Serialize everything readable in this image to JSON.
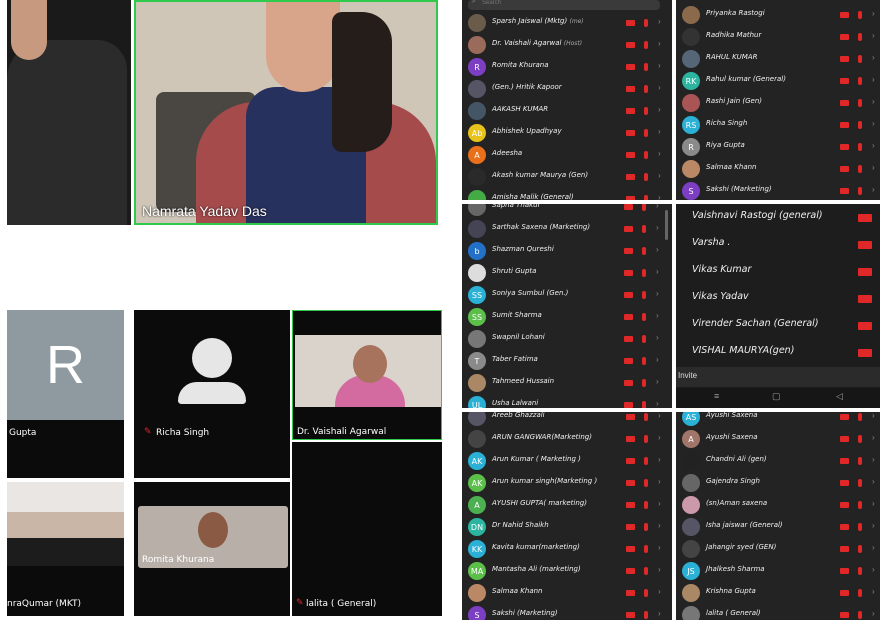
{
  "video": {
    "namrata_label": "Namrata Yadav Das",
    "gupta_label": "Gupta",
    "r_letter": "R",
    "richa_label": "Richa Singh",
    "vaishali_label": "Dr. Vaishali Agarwal",
    "romita_label": "Romita Khurana",
    "qumar_label": "nraQumar (MKT)",
    "lalita_label": "lalita ( General)"
  },
  "panel_a": {
    "search_placeholder": "Search",
    "rows": [
      {
        "name": "Sparsh Jaiswal (Mktg)",
        "note": "(me)",
        "initial": "",
        "color": "#6b5b4b"
      },
      {
        "name": "Dr. Vaishali Agarwal",
        "note": "(Host)",
        "initial": "",
        "color": "#9a6b5a"
      },
      {
        "name": "Romita Khurana",
        "note": "",
        "initial": "R",
        "color": "#7c3fc4"
      },
      {
        "name": "(Gen.) Hritik Kapoor",
        "note": "",
        "initial": "",
        "color": "#556"
      },
      {
        "name": "AAKASH KUMAR",
        "note": "",
        "initial": "",
        "color": "#445566"
      },
      {
        "name": "Abhishek Upadhyay",
        "note": "",
        "initial": "Ab",
        "color": "#e6c21a"
      },
      {
        "name": "Adeesha",
        "note": "",
        "initial": "A",
        "color": "#e8701a"
      },
      {
        "name": "Akash kumar Maurya (Gen)",
        "note": "",
        "initial": "",
        "color": "#2a2a2a"
      },
      {
        "name": "Amisha Malik (General)",
        "note": "",
        "initial": "",
        "color": "#4a4"
      }
    ]
  },
  "panel_b": {
    "rows": [
      {
        "name": "Priyanka Rastogi",
        "initial": "",
        "color": "#8a6a4a"
      },
      {
        "name": "Radhika Mathur",
        "initial": "",
        "color": "#333"
      },
      {
        "name": "RAHUL KUMAR",
        "initial": "",
        "color": "#556677"
      },
      {
        "name": "Rahul kumar (General)",
        "initial": "RK",
        "color": "#2bb5a0"
      },
      {
        "name": "Rashi Jain (Gen)",
        "initial": "",
        "color": "#a55"
      },
      {
        "name": "Richa Singh",
        "initial": "RS",
        "color": "#2bb0d6"
      },
      {
        "name": "Riya Gupta",
        "initial": "R",
        "color": "#8a8a8a"
      },
      {
        "name": "Salmaa Khann",
        "initial": "",
        "color": "#b86"
      },
      {
        "name": "Sakshi (Marketing)",
        "initial": "S",
        "color": "#7c3fc4"
      }
    ]
  },
  "panel_c": {
    "rows": [
      {
        "name": "Sapna Thakur",
        "initial": "",
        "color": "#666"
      },
      {
        "name": "Sarthak Saxena (Marketing)",
        "initial": "",
        "color": "#445"
      },
      {
        "name": "Shazman Qureshi",
        "initial": "b",
        "color": "#2270c8"
      },
      {
        "name": "Shruti Gupta",
        "initial": "",
        "color": "#ddd"
      },
      {
        "name": "Soniya Sumbul (Gen.)",
        "initial": "SS",
        "color": "#2bb0d6"
      },
      {
        "name": "Sumit Sharma",
        "initial": "SS",
        "color": "#5cbf4a"
      },
      {
        "name": "Swapnil Lohani",
        "initial": "",
        "color": "#777"
      },
      {
        "name": "Taber Fatima",
        "initial": "T",
        "color": "#8a8a8a"
      },
      {
        "name": "Tahmeed Hussain",
        "initial": "",
        "color": "#a86"
      },
      {
        "name": "Usha Lalwani",
        "initial": "UL",
        "color": "#2bb0d6"
      }
    ]
  },
  "panel_d": {
    "rows": [
      {
        "name": "Vaishnavi Rastogi (general)"
      },
      {
        "name": "Varsha ."
      },
      {
        "name": "Vikas Kumar"
      },
      {
        "name": "Vikas Yadav"
      },
      {
        "name": "Virender Sachan (General)"
      },
      {
        "name": "VISHAL MAURYA(gen)"
      }
    ],
    "invite_label": "Invite"
  },
  "panel_e": {
    "rows": [
      {
        "name": "Areeb Ghazzali",
        "initial": "",
        "color": "#556"
      },
      {
        "name": "ARUN GANGWAR(Marketing)",
        "initial": "",
        "color": "#444"
      },
      {
        "name": "Arun Kumar ( Marketing )",
        "initial": "AK",
        "color": "#2bb0d6"
      },
      {
        "name": "Arun kumar singh(Marketing )",
        "initial": "AK",
        "color": "#5cbf4a"
      },
      {
        "name": "AYUSHI GUPTA( marketing)",
        "initial": "A",
        "color": "#4caf50"
      },
      {
        "name": "Dr Nahid Shaikh",
        "initial": "DN",
        "color": "#2bb5a0"
      },
      {
        "name": "Kavita kumar(marketing)",
        "initial": "KK",
        "color": "#2bb0d6"
      },
      {
        "name": "Mantasha Ali (marketing)",
        "initial": "MA",
        "color": "#5cbf4a"
      },
      {
        "name": "Salmaa Khann",
        "initial": "",
        "color": "#b86"
      },
      {
        "name": "Sakshi (Marketing)",
        "initial": "S",
        "color": "#7c3fc4"
      }
    ]
  },
  "panel_f": {
    "rows": [
      {
        "name": "Ayushi Saxena",
        "initial": "AS",
        "color": "#2bb0d6"
      },
      {
        "name": "Ayushi Saxena",
        "initial": "A",
        "color": "#a0766a"
      },
      {
        "name": "Chandni Ali (gen)",
        "initial": "",
        "color": "#222"
      },
      {
        "name": "Gajendra Singh",
        "initial": "",
        "color": "#666"
      },
      {
        "name": "(sn)Aman saxena",
        "initial": "",
        "color": "#c9a"
      },
      {
        "name": "Isha jaiswar (General)",
        "initial": "",
        "color": "#556"
      },
      {
        "name": "Jahangir syed (GEN)",
        "initial": "",
        "color": "#444"
      },
      {
        "name": "Jhalkesh Sharma",
        "initial": "JS",
        "color": "#2bb0d6"
      },
      {
        "name": "Krishna Gupta",
        "initial": "",
        "color": "#a86"
      },
      {
        "name": "lalita ( General)",
        "initial": "",
        "color": "#777"
      }
    ]
  },
  "colors": {
    "red": "#e02828",
    "green": "#3fd13f",
    "panel": "#232323"
  }
}
